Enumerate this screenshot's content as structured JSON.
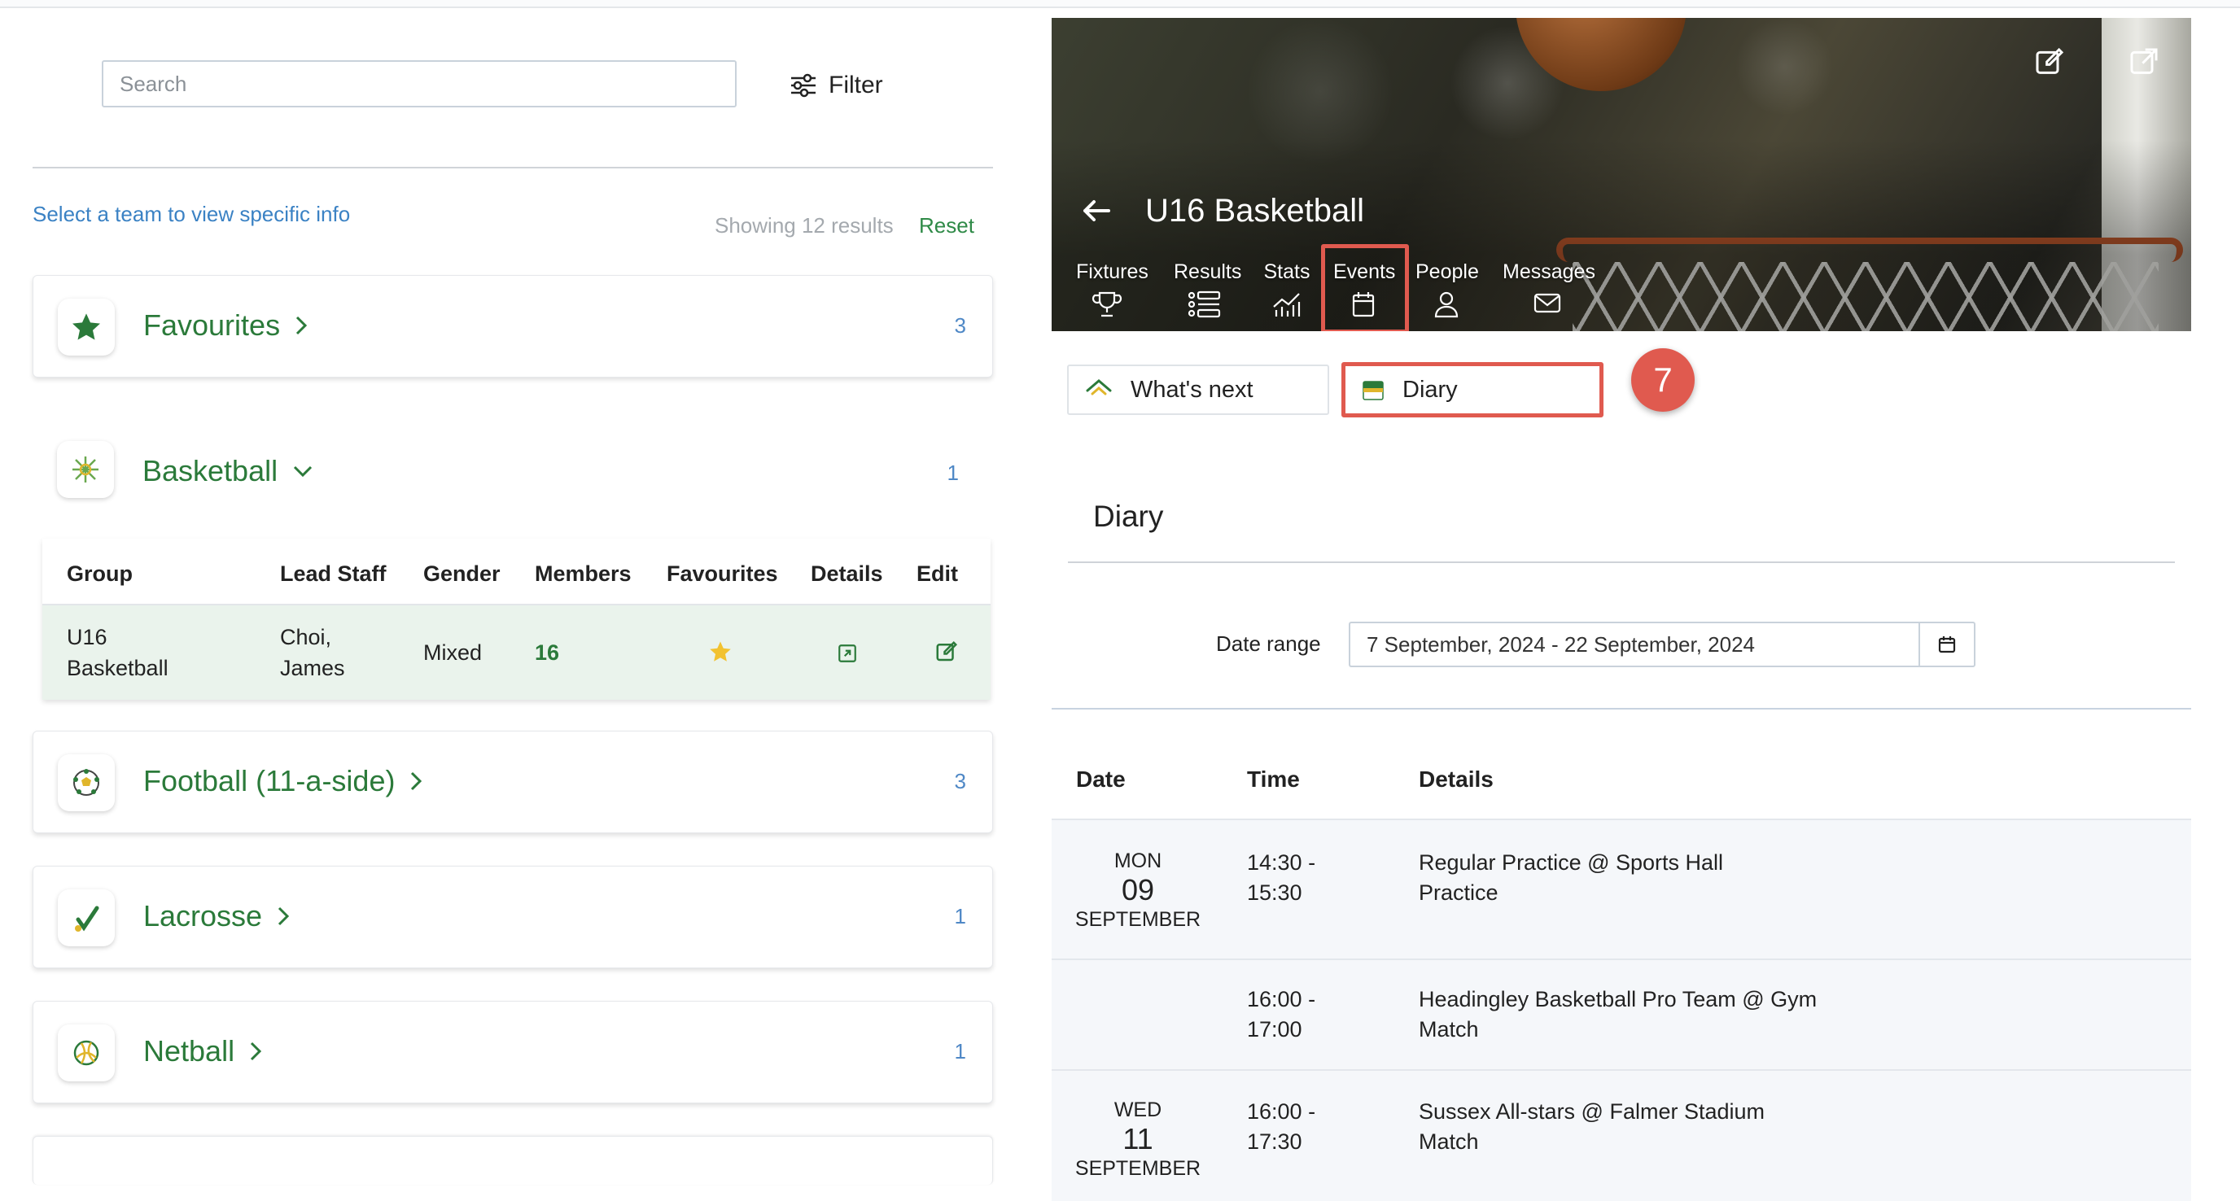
{
  "search": {
    "placeholder": "Search"
  },
  "filter": {
    "label": "Filter"
  },
  "hint": "Select a team to view specific info",
  "results": {
    "showing": "Showing 12 results",
    "reset": "Reset"
  },
  "categories": [
    {
      "name": "Favourites",
      "count": "3",
      "icon": "star-icon"
    },
    {
      "name": "Basketball",
      "count": "1",
      "icon": "basketball-icon"
    },
    {
      "name": "Football (11-a-side)",
      "count": "3",
      "icon": "football-icon"
    },
    {
      "name": "Lacrosse",
      "count": "1",
      "icon": "lacrosse-icon"
    },
    {
      "name": "Netball",
      "count": "1",
      "icon": "netball-icon"
    }
  ],
  "group_table": {
    "headers": [
      "Group",
      "Lead Staff",
      "Gender",
      "Members",
      "Favourites",
      "Details",
      "Edit"
    ],
    "row": {
      "group_line1": "U16",
      "group_line2": "Basketball",
      "staff_line1": "Choi,",
      "staff_line2": "James",
      "gender": "Mixed",
      "members": "16"
    }
  },
  "team": {
    "title": "U16 Basketball",
    "tabs": [
      "Fixtures",
      "Results",
      "Stats",
      "Events",
      "People",
      "Messages"
    ]
  },
  "subtabs": {
    "whats_next": "What's next",
    "diary": "Diary"
  },
  "step_badge": "7",
  "diary": {
    "title": "Diary",
    "date_range_label": "Date range",
    "date_range_value": "7 September, 2024 - 22 September, 2024",
    "headers": [
      "Date",
      "Time",
      "Details"
    ],
    "rows": [
      {
        "dow": "MON",
        "day": "09",
        "month": "SEPTEMBER",
        "time1": "14:30 -",
        "time2": "15:30",
        "detail1": "Regular Practice @ Sports Hall",
        "detail2": "Practice"
      },
      {
        "dow": "",
        "day": "",
        "month": "",
        "time1": "16:00 -",
        "time2": "17:00",
        "detail1": "Headingley Basketball Pro Team @ Gym",
        "detail2": "Match"
      },
      {
        "dow": "WED",
        "day": "11",
        "month": "SEPTEMBER",
        "time1": "16:00 -",
        "time2": "17:30",
        "detail1": "Sussex All-stars @ Falmer Stadium",
        "detail2": "Match"
      }
    ]
  },
  "colors": {
    "green": "#2b7a3a",
    "highlight": "#e05a4f",
    "link": "#3b82c4"
  }
}
